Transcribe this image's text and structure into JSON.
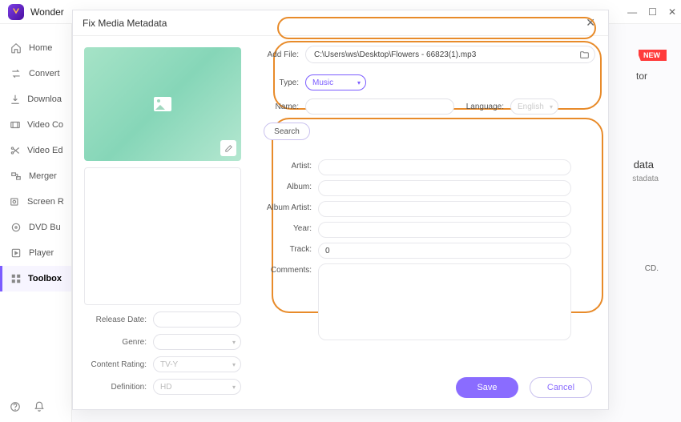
{
  "app_name": "Wonder",
  "new_badge": "NEW",
  "bg": {
    "tor": "tor",
    "data": "data",
    "stadata": "stadata",
    "cd": "CD."
  },
  "sidebar": {
    "items": [
      {
        "label": "Home"
      },
      {
        "label": "Convert"
      },
      {
        "label": "Downloa"
      },
      {
        "label": "Video Co"
      },
      {
        "label": "Video Ed"
      },
      {
        "label": "Merger"
      },
      {
        "label": "Screen R"
      },
      {
        "label": "DVD Bu"
      },
      {
        "label": "Player"
      },
      {
        "label": "Toolbox"
      }
    ]
  },
  "modal": {
    "title": "Fix Media Metadata",
    "add_file_label": "Add File:",
    "file_path": "C:\\Users\\ws\\Desktop\\Flowers - 66823(1).mp3",
    "type_label": "Type:",
    "type_value": "Music",
    "name_label": "Name:",
    "name_value": "",
    "language_label": "Language:",
    "language_value": "English",
    "search_label": "Search",
    "fields": {
      "artist_label": "Artist:",
      "album_label": "Album:",
      "album_artist_label": "Album Artist:",
      "year_label": "Year:",
      "track_label": "Track:",
      "track_value": "0",
      "comments_label": "Comments:"
    },
    "left": {
      "release_date_label": "Release Date:",
      "genre_label": "Genre:",
      "content_rating_label": "Content Rating:",
      "content_rating_value": "TV-Y",
      "definition_label": "Definition:",
      "definition_value": "HD"
    },
    "save": "Save",
    "cancel": "Cancel"
  }
}
